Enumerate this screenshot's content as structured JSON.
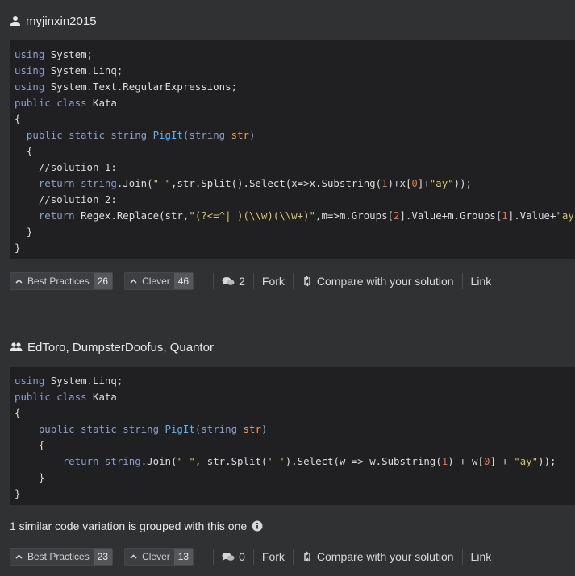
{
  "solutions": [
    {
      "users": "myjinxin2015",
      "code_lines": [
        [
          {
            "t": "using",
            "c": "kw"
          },
          {
            "t": " System;"
          }
        ],
        [
          {
            "t": "using",
            "c": "kw"
          },
          {
            "t": " System.Linq;"
          }
        ],
        [
          {
            "t": "using",
            "c": "kw"
          },
          {
            "t": " System.Text.RegularExpressions;"
          }
        ],
        [
          {
            "t": "public class",
            "c": "kw"
          },
          {
            "t": " Kata"
          }
        ],
        [
          {
            "t": "{"
          }
        ],
        [
          {
            "t": "  "
          },
          {
            "t": "public static string",
            "c": "kw"
          },
          {
            "t": " "
          },
          {
            "t": "PigIt",
            "c": "fn"
          },
          {
            "t": "(",
            "c": "kw"
          },
          {
            "t": "string",
            "c": "kw"
          },
          {
            "t": " "
          },
          {
            "t": "str",
            "c": "pa"
          },
          {
            "t": ")",
            "c": "kw"
          }
        ],
        [
          {
            "t": "  {"
          }
        ],
        [
          {
            "t": "    //solution 1:"
          }
        ],
        [
          {
            "t": "    "
          },
          {
            "t": "return",
            "c": "kw"
          },
          {
            "t": " "
          },
          {
            "t": "string",
            "c": "kw"
          },
          {
            "t": ".Join("
          },
          {
            "t": "\" \"",
            "c": "st"
          },
          {
            "t": ",str.Split().Select(x=>x.Substring("
          },
          {
            "t": "1",
            "c": "nu"
          },
          {
            "t": ")+x["
          },
          {
            "t": "0",
            "c": "nu"
          },
          {
            "t": "]+"
          },
          {
            "t": "\"ay\"",
            "c": "st"
          },
          {
            "t": "));"
          }
        ],
        [
          {
            "t": "    //solution 2:"
          }
        ],
        [
          {
            "t": "    "
          },
          {
            "t": "return",
            "c": "kw"
          },
          {
            "t": " Regex.Replace(str,"
          },
          {
            "t": "\"(?<=^| )(\\\\w)(\\\\w+)\"",
            "c": "st"
          },
          {
            "t": ",m=>m.Groups["
          },
          {
            "t": "2",
            "c": "nu"
          },
          {
            "t": "].Value+m.Groups["
          },
          {
            "t": "1",
            "c": "nu"
          },
          {
            "t": "].Value+"
          },
          {
            "t": "\"ay\"",
            "c": "st"
          },
          {
            "t": ");"
          }
        ],
        [
          {
            "t": "  }"
          }
        ],
        [
          {
            "t": "}"
          }
        ]
      ],
      "best_practices_label": "Best Practices",
      "best_practices_count": "26",
      "clever_label": "Clever",
      "clever_count": "46",
      "comments_count": "2",
      "fork_label": "Fork",
      "compare_label": "Compare with your solution",
      "link_label": "Link"
    },
    {
      "users": "EdToro, DumpsterDoofus, Quantor",
      "code_lines": [
        [
          {
            "t": "using",
            "c": "kw"
          },
          {
            "t": " System.Linq;"
          }
        ],
        [
          {
            "t": "public class",
            "c": "kw"
          },
          {
            "t": " Kata"
          }
        ],
        [
          {
            "t": "{"
          }
        ],
        [
          {
            "t": "    "
          },
          {
            "t": "public static string",
            "c": "kw"
          },
          {
            "t": " "
          },
          {
            "t": "PigIt",
            "c": "fn"
          },
          {
            "t": "(",
            "c": "kw"
          },
          {
            "t": "string",
            "c": "kw"
          },
          {
            "t": " "
          },
          {
            "t": "str",
            "c": "pa"
          },
          {
            "t": ")",
            "c": "kw"
          }
        ],
        [
          {
            "t": "    {"
          }
        ],
        [
          {
            "t": "        "
          },
          {
            "t": "return",
            "c": "kw"
          },
          {
            "t": " "
          },
          {
            "t": "string",
            "c": "kw"
          },
          {
            "t": ".Join("
          },
          {
            "t": "\" \"",
            "c": "st"
          },
          {
            "t": ", str.Split("
          },
          {
            "t": "' '",
            "c": "st"
          },
          {
            "t": ").Select(w => w.Substring("
          },
          {
            "t": "1",
            "c": "nu"
          },
          {
            "t": ") + w["
          },
          {
            "t": "0",
            "c": "nu"
          },
          {
            "t": "] + "
          },
          {
            "t": "\"ay\"",
            "c": "st"
          },
          {
            "t": "));"
          }
        ],
        [
          {
            "t": "    }"
          }
        ],
        [
          {
            "t": "}"
          }
        ]
      ],
      "variation_text": "1 similar code variation is grouped with this one",
      "best_practices_label": "Best Practices",
      "best_practices_count": "23",
      "clever_label": "Clever",
      "clever_count": "13",
      "comments_count": "0",
      "fork_label": "Fork",
      "compare_label": "Compare with your solution",
      "link_label": "Link"
    }
  ],
  "colors": {
    "background": "#303133",
    "code_background": "#202022",
    "keyword": "#8d9fc6",
    "function": "#6ab0e8",
    "param": "#f09b5a",
    "string": "#d9c36e",
    "number": "#e8734e"
  }
}
